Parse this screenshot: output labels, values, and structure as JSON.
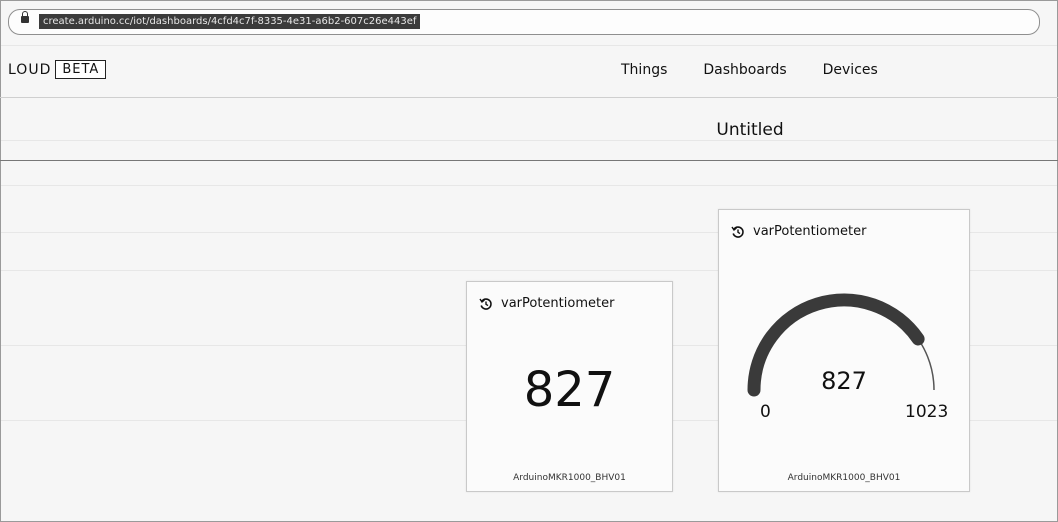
{
  "browser": {
    "url": "create.arduino.cc/iot/dashboards/4cfd4c7f-8335-4e31-a6b2-607c26e443ef"
  },
  "header": {
    "brand": "LOUD",
    "badge": "BETA",
    "nav": [
      "Things",
      "Dashboards",
      "Devices"
    ]
  },
  "dashboard": {
    "title": "Untitled"
  },
  "widgets": {
    "value_widget": {
      "variable": "varPotentiometer",
      "value": "827",
      "device": "ArduinoMKR1000_BHV01"
    },
    "gauge_widget": {
      "variable": "varPotentiometer",
      "value": "827",
      "min": "0",
      "max": "1023",
      "level": 0.808,
      "device": "ArduinoMKR1000_BHV01"
    }
  },
  "colors": {
    "gauge_fill": "#3a3a3a",
    "gauge_track": "#555555",
    "url_highlight": "#3b3b3b"
  }
}
